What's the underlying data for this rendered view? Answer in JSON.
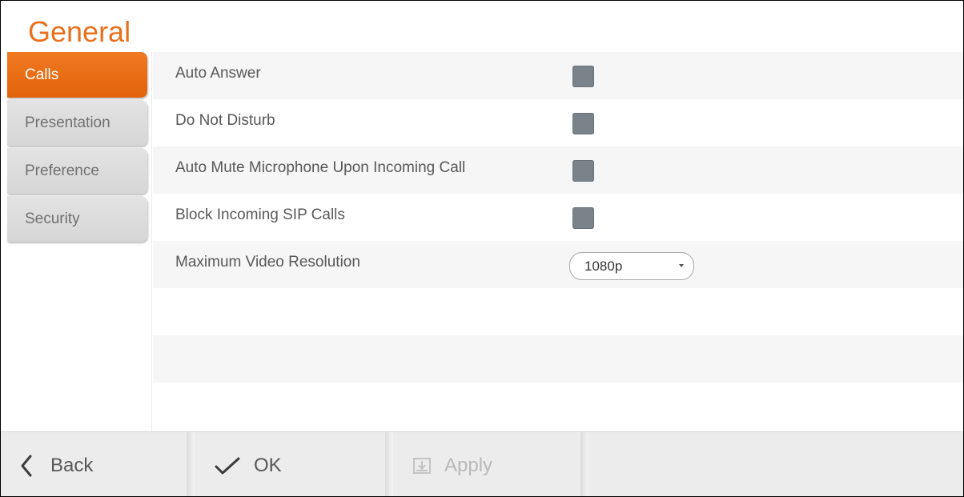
{
  "page": {
    "title": "General"
  },
  "sidebar": {
    "items": [
      {
        "label": "Calls",
        "active": true
      },
      {
        "label": "Presentation",
        "active": false
      },
      {
        "label": "Preference",
        "active": false
      },
      {
        "label": "Security",
        "active": false
      }
    ]
  },
  "settings": {
    "auto_answer": {
      "label": "Auto Answer",
      "checked": false
    },
    "do_not_disturb": {
      "label": "Do Not Disturb",
      "checked": false
    },
    "auto_mute": {
      "label": "Auto Mute Microphone Upon Incoming Call",
      "checked": false
    },
    "block_sip": {
      "label": "Block Incoming SIP Calls",
      "checked": false
    },
    "max_resolution": {
      "label": "Maximum Video Resolution",
      "value": "1080p"
    }
  },
  "footer": {
    "back_label": "Back",
    "ok_label": "OK",
    "apply_label": "Apply"
  },
  "colors": {
    "accent": "#e8701e",
    "checkbox": "#7a828a",
    "text": "#585858"
  },
  "icons": {
    "back": "chevron-left-icon",
    "ok": "checkmark-icon",
    "apply": "apply-icon",
    "dropdown": "caret-down-icon"
  }
}
